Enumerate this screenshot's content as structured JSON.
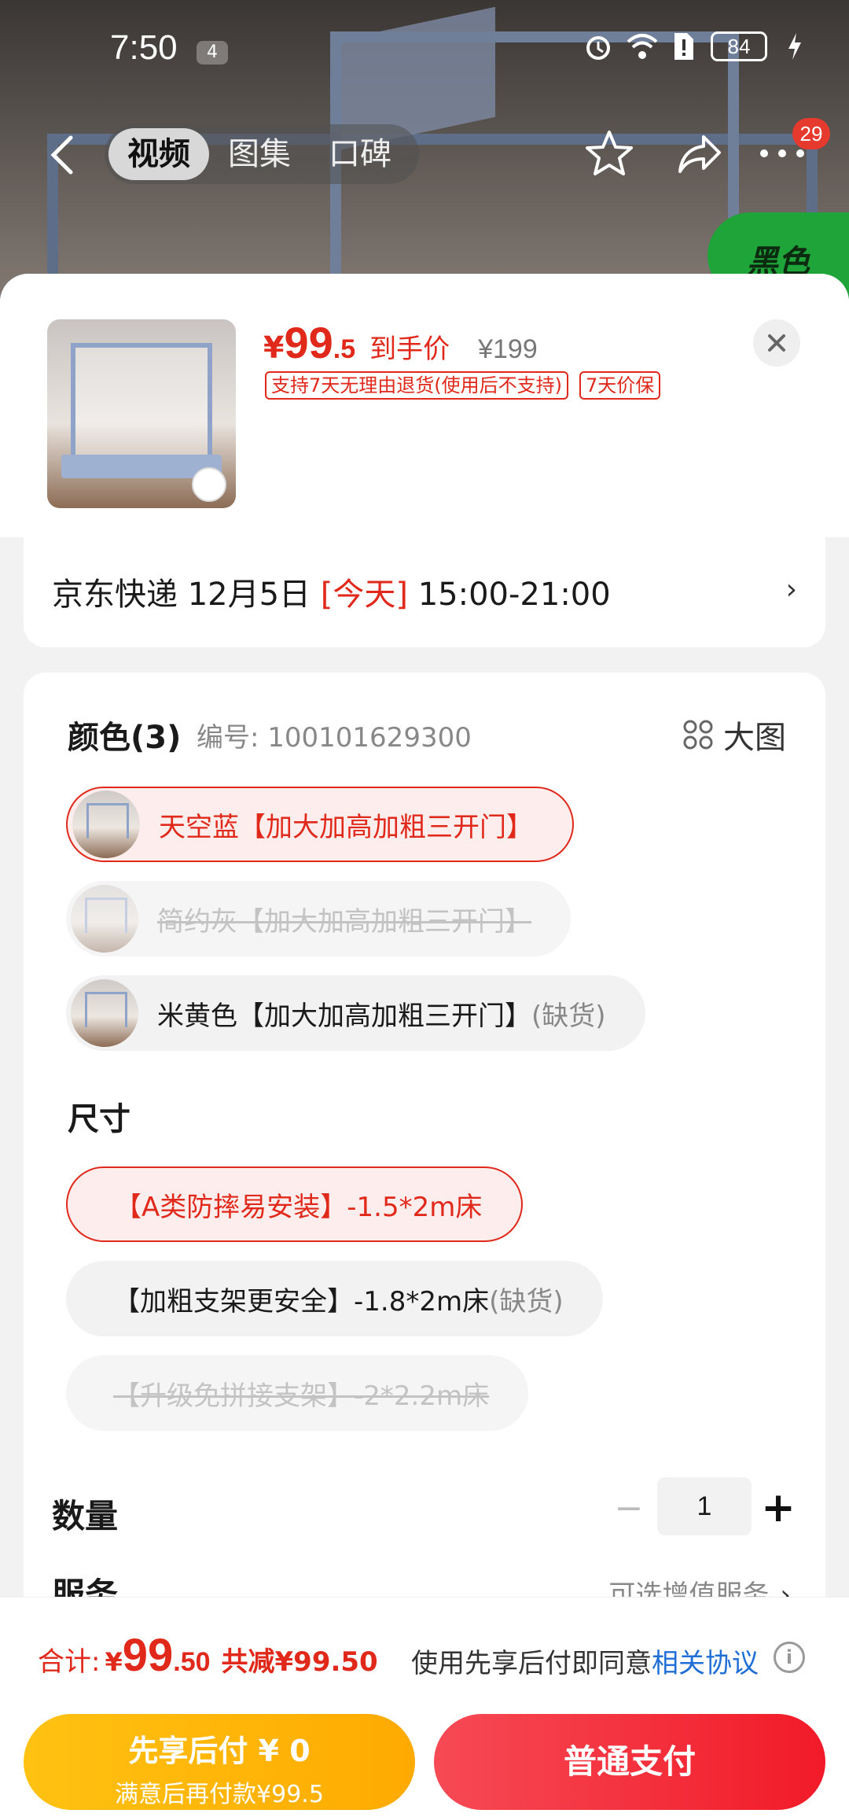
{
  "status_bar": {
    "time": "7:50",
    "notif_count": "4",
    "battery": "84"
  },
  "topnav": {
    "tabs": [
      {
        "label": "视频"
      },
      {
        "label": "图集"
      },
      {
        "label": "口碑"
      }
    ],
    "more_badge": "29",
    "corner_badge": "黑色"
  },
  "product": {
    "currency": "¥",
    "price_int": "99",
    "price_dec": ".5",
    "price_label": "到手价",
    "original_price": "¥199",
    "tags": [
      "支持7天无理由退货(使用后不支持)",
      "7天价保"
    ]
  },
  "delivery": {
    "carrier_date": "京东快递 12月5日 ",
    "today": "[今天]",
    "window": " 15:00-21:00"
  },
  "color": {
    "title": "颜色(3)",
    "code": "编号: 100101629300",
    "big_pic": "大图",
    "options": [
      {
        "label": "天空蓝【加大加高加粗三开门】",
        "suffix": "",
        "state": "selected"
      },
      {
        "label": "简约灰【加大加高加粗三开门】",
        "suffix": "",
        "state": "disabled"
      },
      {
        "label": "米黄色【加大加高加粗三开门】",
        "suffix": "(缺货)",
        "state": "oos"
      }
    ]
  },
  "size": {
    "title": "尺寸",
    "options": [
      {
        "label": "【A类防摔易安装】-1.5*2m床",
        "suffix": "",
        "state": "selected"
      },
      {
        "label": "【加粗支架更安全】-1.8*2m床",
        "suffix": "(缺货)",
        "state": "oos"
      },
      {
        "label": "【升级免拼接支架】-2*2.2m床",
        "suffix": "",
        "state": "disabled"
      }
    ]
  },
  "quantity": {
    "label": "数量",
    "value": "1"
  },
  "service": {
    "label": "服务",
    "hint": "可选增值服务"
  },
  "footer": {
    "total_label": "合计:",
    "currency": "¥",
    "total_int": "99",
    "total_dec": ".50",
    "discount": "共减¥99.50",
    "agree_text": "使用先享后付即同意",
    "agree_link": "相关协议",
    "later_title": "先享后付 ¥ 0",
    "later_sub": "满意后再付款¥99.5",
    "pay_label": "普通支付"
  },
  "colors": {
    "accent": "#e0291b",
    "pay": "#f21a28",
    "later": "#ffaa00",
    "link": "#1f6fd6"
  }
}
